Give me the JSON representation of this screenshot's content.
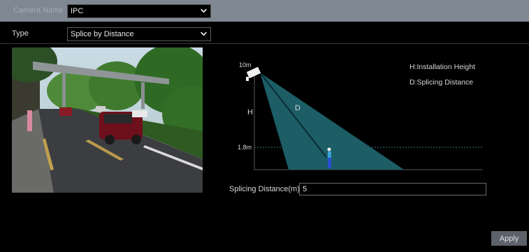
{
  "header": {
    "camera_name_label": "Camera Name",
    "camera_select_value": "IPC"
  },
  "type_row": {
    "label": "Type",
    "select_value": "Splice by Distance"
  },
  "diagram": {
    "top_height_label": "10m",
    "bottom_height_label": "1.8m",
    "h_label": "H",
    "d_label": "D",
    "legend_h": "H:Installation Height",
    "legend_d": "D:Splicing Distance"
  },
  "splice": {
    "label": "Splicing Distance(m)",
    "value": "5"
  },
  "apply_button": "Apply",
  "colors": {
    "header_bar": "#7f8892",
    "cone_fill": "#1c5d66",
    "dashed_line": "#2a7880",
    "button_bg": "#5d6169"
  },
  "icons": {
    "dropdown": "chevron-down-icon",
    "camera": "camera-icon",
    "person": "person-icon"
  }
}
